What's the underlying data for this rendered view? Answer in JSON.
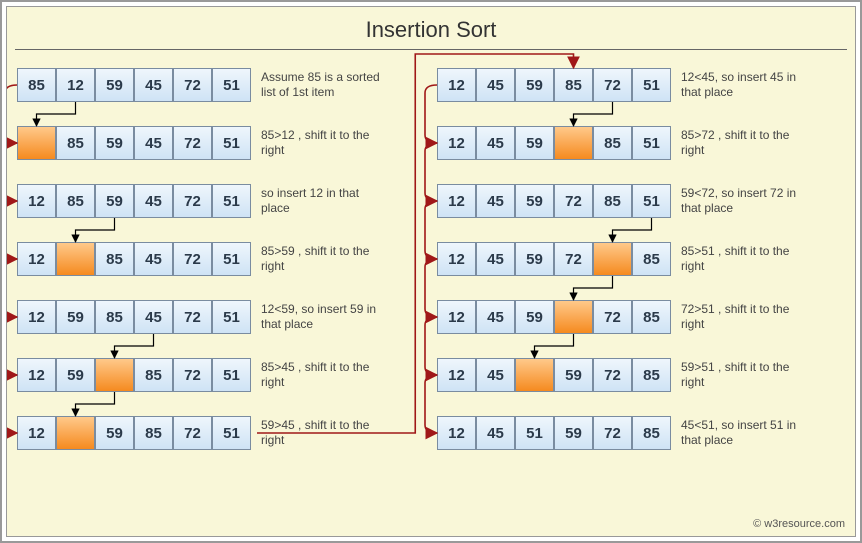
{
  "title": "Insertion   Sort",
  "credit": "© w3resource.com",
  "columns": [
    {
      "steps": [
        {
          "cells": [
            "85",
            "12",
            "59",
            "45",
            "72",
            "51"
          ],
          "hi": [],
          "caption": "Assume 85 is a sorted list of 1st item"
        },
        {
          "cells": [
            "",
            "85",
            "59",
            "45",
            "72",
            "51"
          ],
          "hi": [
            0
          ],
          "caption": "85>12 , shift it to the right"
        },
        {
          "cells": [
            "12",
            "85",
            "59",
            "45",
            "72",
            "51"
          ],
          "hi": [],
          "caption": "so insert 12 in that place"
        },
        {
          "cells": [
            "12",
            "",
            "85",
            "45",
            "72",
            "51"
          ],
          "hi": [
            1
          ],
          "caption": "85>59 , shift it to the right"
        },
        {
          "cells": [
            "12",
            "59",
            "85",
            "45",
            "72",
            "51"
          ],
          "hi": [],
          "caption": "12<59, so insert 59 in that place"
        },
        {
          "cells": [
            "12",
            "59",
            "",
            "85",
            "72",
            "51"
          ],
          "hi": [
            2
          ],
          "caption": "85>45 , shift it to the right"
        },
        {
          "cells": [
            "12",
            "",
            "59",
            "85",
            "72",
            "51"
          ],
          "hi": [
            1
          ],
          "caption": "59>45 , shift it to the right"
        }
      ]
    },
    {
      "steps": [
        {
          "cells": [
            "12",
            "45",
            "59",
            "85",
            "72",
            "51"
          ],
          "hi": [],
          "caption": "12<45, so insert 45 in that place"
        },
        {
          "cells": [
            "12",
            "45",
            "59",
            "",
            "85",
            "51"
          ],
          "hi": [
            3
          ],
          "caption": "85>72 , shift it to the right"
        },
        {
          "cells": [
            "12",
            "45",
            "59",
            "72",
            "85",
            "51"
          ],
          "hi": [],
          "caption": "59<72, so insert 72 in that place"
        },
        {
          "cells": [
            "12",
            "45",
            "59",
            "72",
            "",
            "85"
          ],
          "hi": [
            4
          ],
          "caption": "85>51 , shift it to the right"
        },
        {
          "cells": [
            "12",
            "45",
            "59",
            "",
            "72",
            "85"
          ],
          "hi": [
            3
          ],
          "caption": "72>51 , shift it to the right"
        },
        {
          "cells": [
            "12",
            "45",
            "",
            "59",
            "72",
            "85"
          ],
          "hi": [
            2
          ],
          "caption": "59>51 , shift it to the right"
        },
        {
          "cells": [
            "12",
            "45",
            "51",
            "59",
            "72",
            "85"
          ],
          "hi": [],
          "caption": "45<51, so insert 51 in that place"
        }
      ]
    }
  ],
  "arrows_left": [
    {
      "from_step": 0,
      "from_cell": 1,
      "to_step": 1,
      "to_cell": 0
    },
    {
      "from_step": 2,
      "from_cell": 2,
      "to_step": 3,
      "to_cell": 1
    },
    {
      "from_step": 4,
      "from_cell": 3,
      "to_step": 5,
      "to_cell": 2
    },
    {
      "from_step": 5,
      "from_cell": 2,
      "to_step": 6,
      "to_cell": 1
    }
  ],
  "arrows_right": [
    {
      "from_step": 0,
      "from_cell": 4,
      "to_step": 1,
      "to_cell": 3
    },
    {
      "from_step": 2,
      "from_cell": 5,
      "to_step": 3,
      "to_cell": 4
    },
    {
      "from_step": 3,
      "from_cell": 4,
      "to_step": 4,
      "to_cell": 3
    },
    {
      "from_step": 4,
      "from_cell": 3,
      "to_step": 5,
      "to_cell": 2
    }
  ],
  "connect_left": [
    [
      0,
      1
    ],
    [
      1,
      2
    ],
    [
      2,
      3
    ],
    [
      3,
      4
    ],
    [
      4,
      5
    ],
    [
      5,
      6
    ]
  ],
  "connect_right": [
    [
      0,
      1
    ],
    [
      1,
      2
    ],
    [
      2,
      3
    ],
    [
      3,
      4
    ],
    [
      4,
      5
    ],
    [
      5,
      6
    ]
  ]
}
